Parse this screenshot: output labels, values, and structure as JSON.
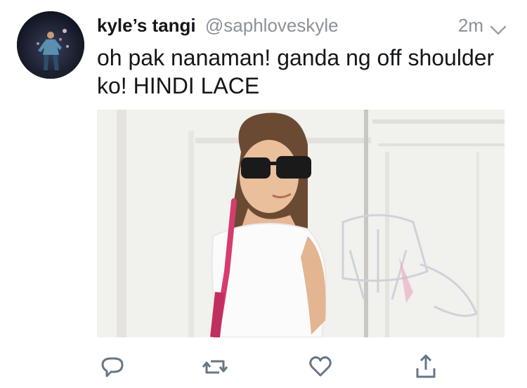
{
  "tweet": {
    "display_name": "kyle’s tangi",
    "handle": "@saphloveskyle",
    "timestamp": "2m",
    "text": "oh pak nanaman! ganda ng off shoulder ko! HINDI LACE"
  },
  "icons": {
    "menu": "chevron-down-icon",
    "reply": "reply-icon",
    "retweet": "retweet-icon",
    "like": "heart-icon",
    "share": "share-icon"
  },
  "colors": {
    "text": "#14171a",
    "secondary": "#8a9197",
    "action_icons": "#657786"
  }
}
